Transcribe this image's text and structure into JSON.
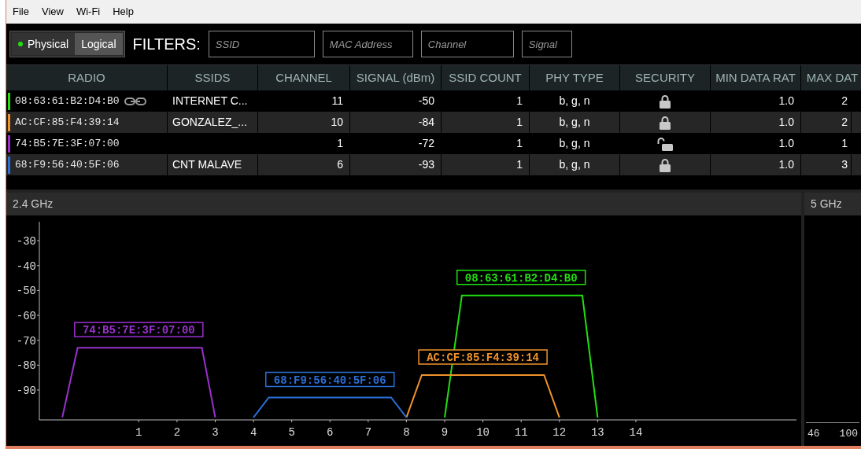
{
  "menu": [
    "File",
    "View",
    "Wi-Fi",
    "Help"
  ],
  "view_toggle": [
    {
      "label": "Physical",
      "selected": true
    },
    {
      "label": "Logical",
      "selected": false
    }
  ],
  "filters": {
    "label": "FILTERS:",
    "fields": [
      {
        "placeholder": "SSID"
      },
      {
        "placeholder": "MAC Address"
      },
      {
        "placeholder": "Channel"
      },
      {
        "placeholder": "Signal"
      }
    ]
  },
  "table": {
    "columns": [
      "RADIO",
      "SSIDS",
      "CHANNEL",
      "SIGNAL (dBm)",
      "SSID COUNT",
      "PHY TYPE",
      "SECURITY",
      "MIN DATA RAT",
      "MAX DAT"
    ],
    "rows": [
      {
        "color": "#22e010",
        "radio": "08:63:61:B2:D4:B0",
        "linked": true,
        "ssids": "INTERNET C...",
        "channel": "11",
        "signal": "-50",
        "ssid_count": "1",
        "phy_type": "b, g, n",
        "secured": true,
        "min_rate": "1.0",
        "max_rate": "2"
      },
      {
        "color": "#f0932b",
        "radio": "AC:CF:85:F4:39:14",
        "linked": false,
        "ssids": "GONZALEZ_...",
        "channel": "10",
        "signal": "-84",
        "ssid_count": "1",
        "phy_type": "b, g, n",
        "secured": true,
        "min_rate": "1.0",
        "max_rate": "2"
      },
      {
        "color": "#9b30d0",
        "radio": "74:B5:7E:3F:07:00",
        "linked": false,
        "ssids": "",
        "channel": "1",
        "signal": "-72",
        "ssid_count": "1",
        "phy_type": "b, g, n",
        "secured": false,
        "min_rate": "1.0",
        "max_rate": "1"
      },
      {
        "color": "#2a6fd6",
        "radio": "68:F9:56:40:5F:06",
        "linked": false,
        "ssids": "CNT MALAVE",
        "channel": "6",
        "signal": "-93",
        "ssid_count": "1",
        "phy_type": "b, g, n",
        "secured": true,
        "min_rate": "1.0",
        "max_rate": "3"
      }
    ]
  },
  "band_24": {
    "title": "2.4 GHz",
    "chart_data": {
      "type": "line",
      "xlim": [
        -1.6,
        18.2
      ],
      "ylim": [
        -102,
        -22.4
      ],
      "yticks": [
        {
          "value": -30,
          "label": "-30"
        },
        {
          "value": -40,
          "label": "-40"
        },
        {
          "value": -50,
          "label": "-50"
        },
        {
          "value": -60,
          "label": "-60"
        },
        {
          "value": -70,
          "label": "-70"
        },
        {
          "value": -80,
          "label": "-80"
        },
        {
          "value": -90,
          "label": "-90"
        }
      ],
      "xticks": [
        1,
        2,
        3,
        4,
        5,
        6,
        7,
        8,
        9,
        10,
        11,
        12,
        13,
        14
      ],
      "series": [
        {
          "name": "08:63:61:B2:D4:B0",
          "color": "#22e010",
          "x": [
            9,
            9.45,
            12.6,
            13
          ],
          "values": [
            -101,
            -52,
            -52,
            -101
          ]
        },
        {
          "name": "AC:CF:85:F4:39:14",
          "color": "#f0932b",
          "x": [
            8,
            8.4,
            11.6,
            12
          ],
          "values": [
            -101,
            -84,
            -84,
            -101
          ]
        },
        {
          "name": "74:B5:7E:3F:07:00",
          "color": "#9b30d0",
          "x": [
            -1,
            -0.6,
            2.65,
            3
          ],
          "values": [
            -101,
            -73,
            -73,
            -101
          ]
        },
        {
          "name": "68:F9:56:40:5F:06",
          "color": "#2a6fd6",
          "x": [
            4,
            4.4,
            7.6,
            8
          ],
          "values": [
            -101,
            -93,
            -93,
            -101
          ]
        }
      ]
    }
  },
  "band_5": {
    "title": "5 GHz",
    "axis_labels": [
      "46",
      "100"
    ]
  }
}
